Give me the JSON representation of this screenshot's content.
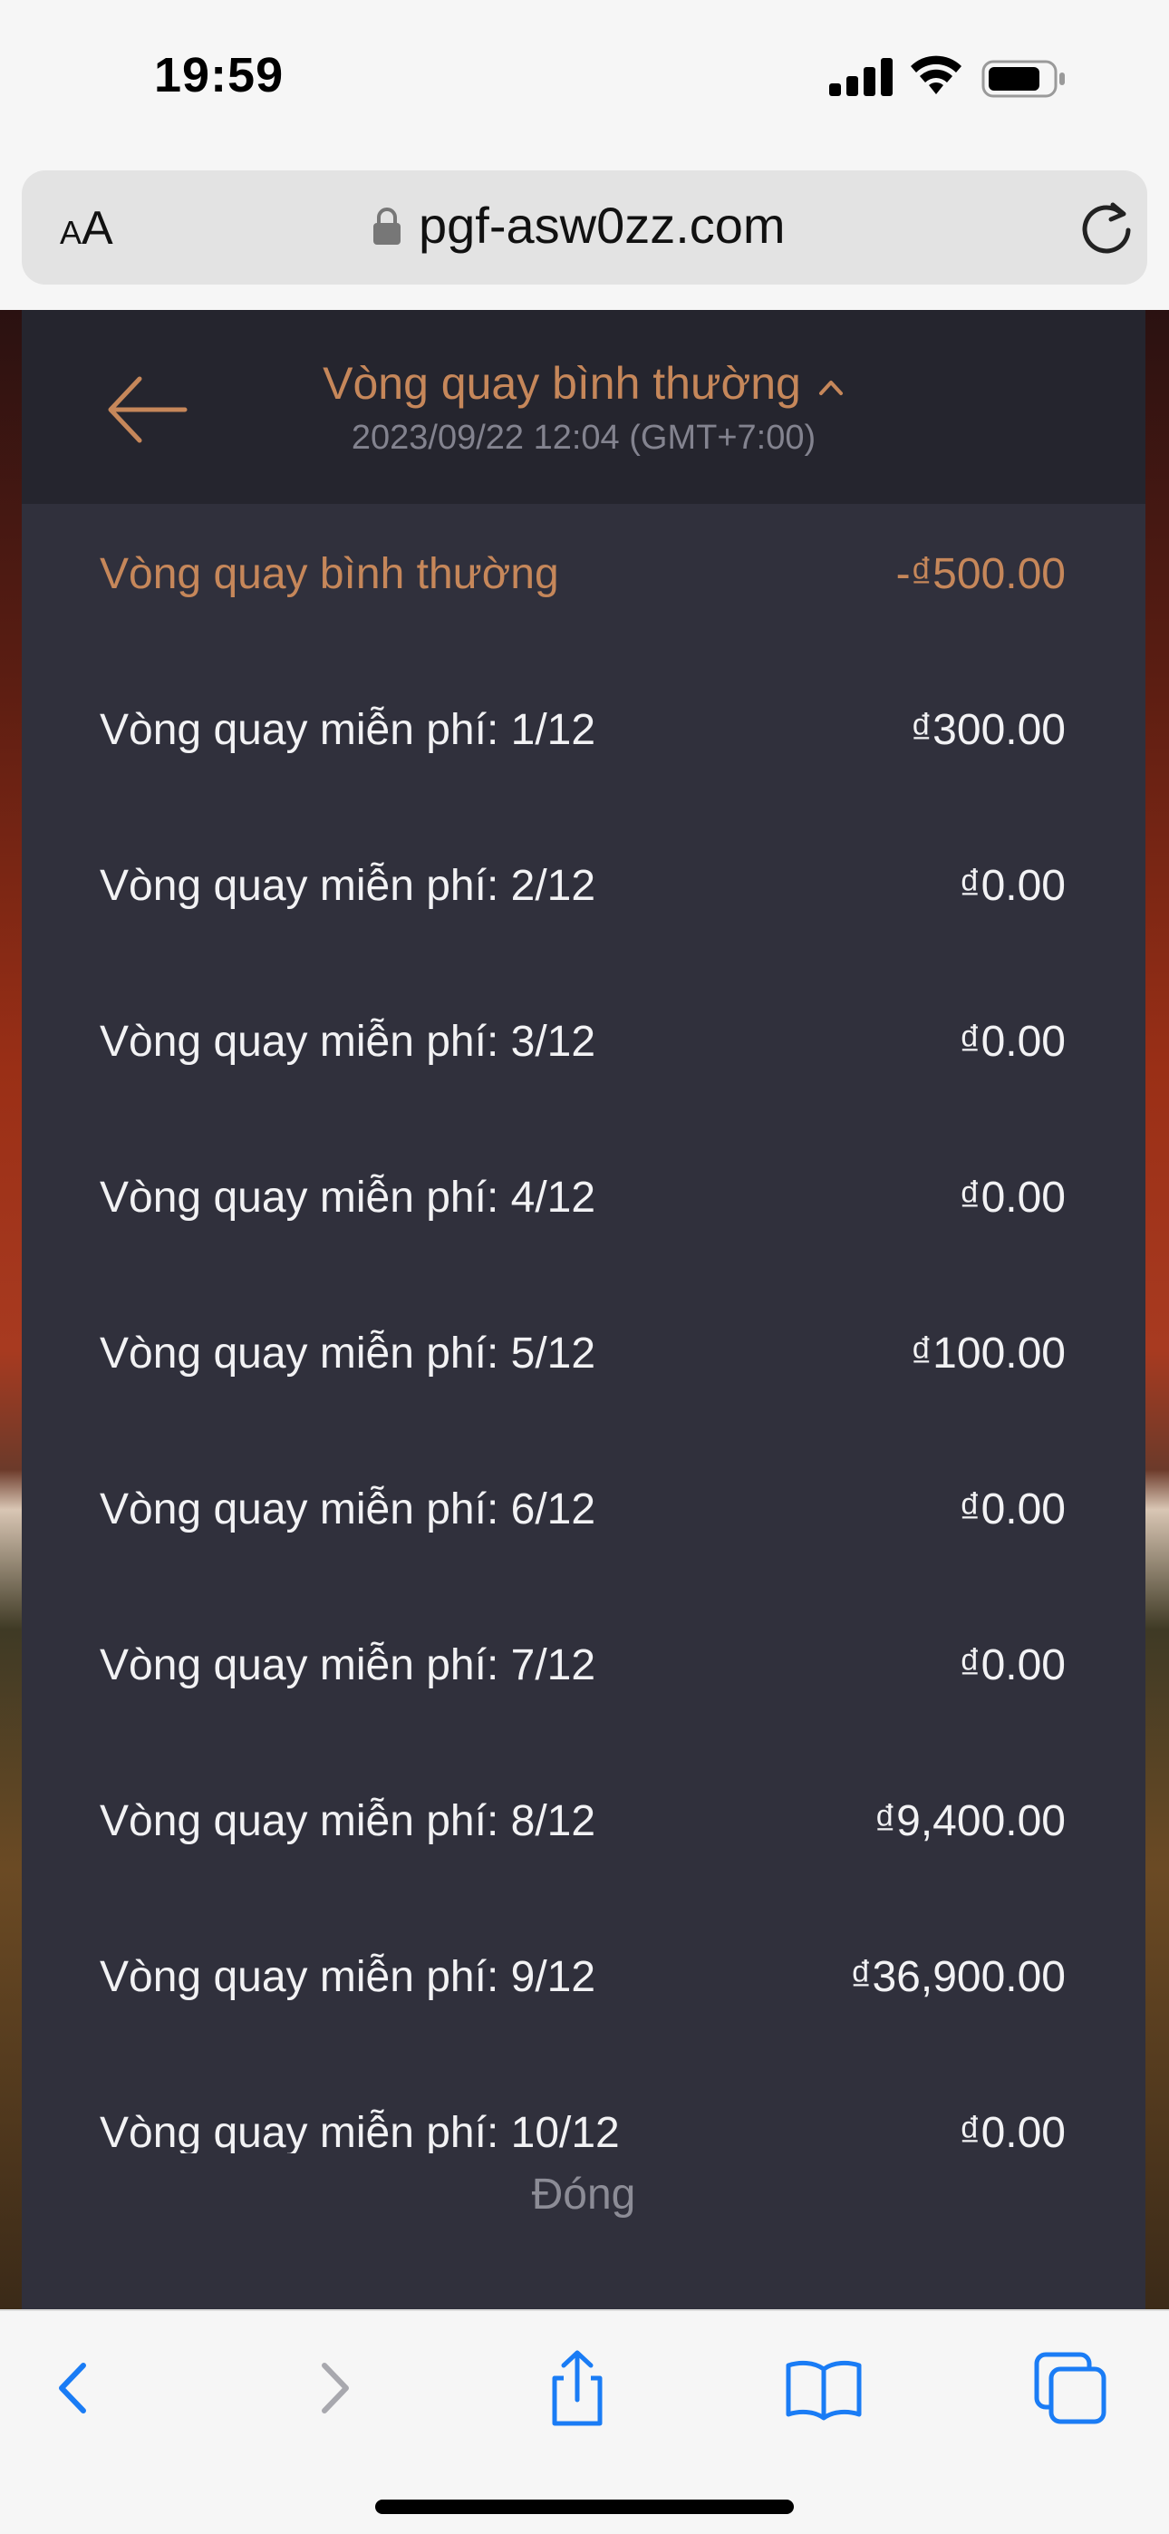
{
  "status_bar": {
    "time": "19:59"
  },
  "browser": {
    "aa_small": "A",
    "aa_big": "A",
    "url": "pgf-asw0zz.com"
  },
  "header": {
    "title": "Vòng quay bình thường",
    "subtitle": "2023/09/22 12:04 (GMT+7:00)"
  },
  "rows": [
    {
      "label": "Vòng quay bình thường",
      "value": "-₫500.00"
    },
    {
      "label": "Vòng quay miễn phí: 1/12",
      "value": "₫300.00"
    },
    {
      "label": "Vòng quay miễn phí: 2/12",
      "value": "₫0.00"
    },
    {
      "label": "Vòng quay miễn phí: 3/12",
      "value": "₫0.00"
    },
    {
      "label": "Vòng quay miễn phí: 4/12",
      "value": "₫0.00"
    },
    {
      "label": "Vòng quay miễn phí: 5/12",
      "value": "₫100.00"
    },
    {
      "label": "Vòng quay miễn phí: 6/12",
      "value": "₫0.00"
    },
    {
      "label": "Vòng quay miễn phí: 7/12",
      "value": "₫0.00"
    },
    {
      "label": "Vòng quay miễn phí: 8/12",
      "value": "₫9,400.00"
    },
    {
      "label": "Vòng quay miễn phí: 9/12",
      "value": "₫36,900.00"
    },
    {
      "label": "Vòng quay miễn phí: 10/12",
      "value": "₫0.00"
    }
  ],
  "close_label": "Đóng",
  "colors": {
    "accent": "#c6875a",
    "panel": "#30303c",
    "ios_blue": "#1a7cf5"
  },
  "toolbar_icons": [
    "back-icon",
    "forward-icon",
    "share-icon",
    "bookmarks-icon",
    "tabs-icon"
  ]
}
